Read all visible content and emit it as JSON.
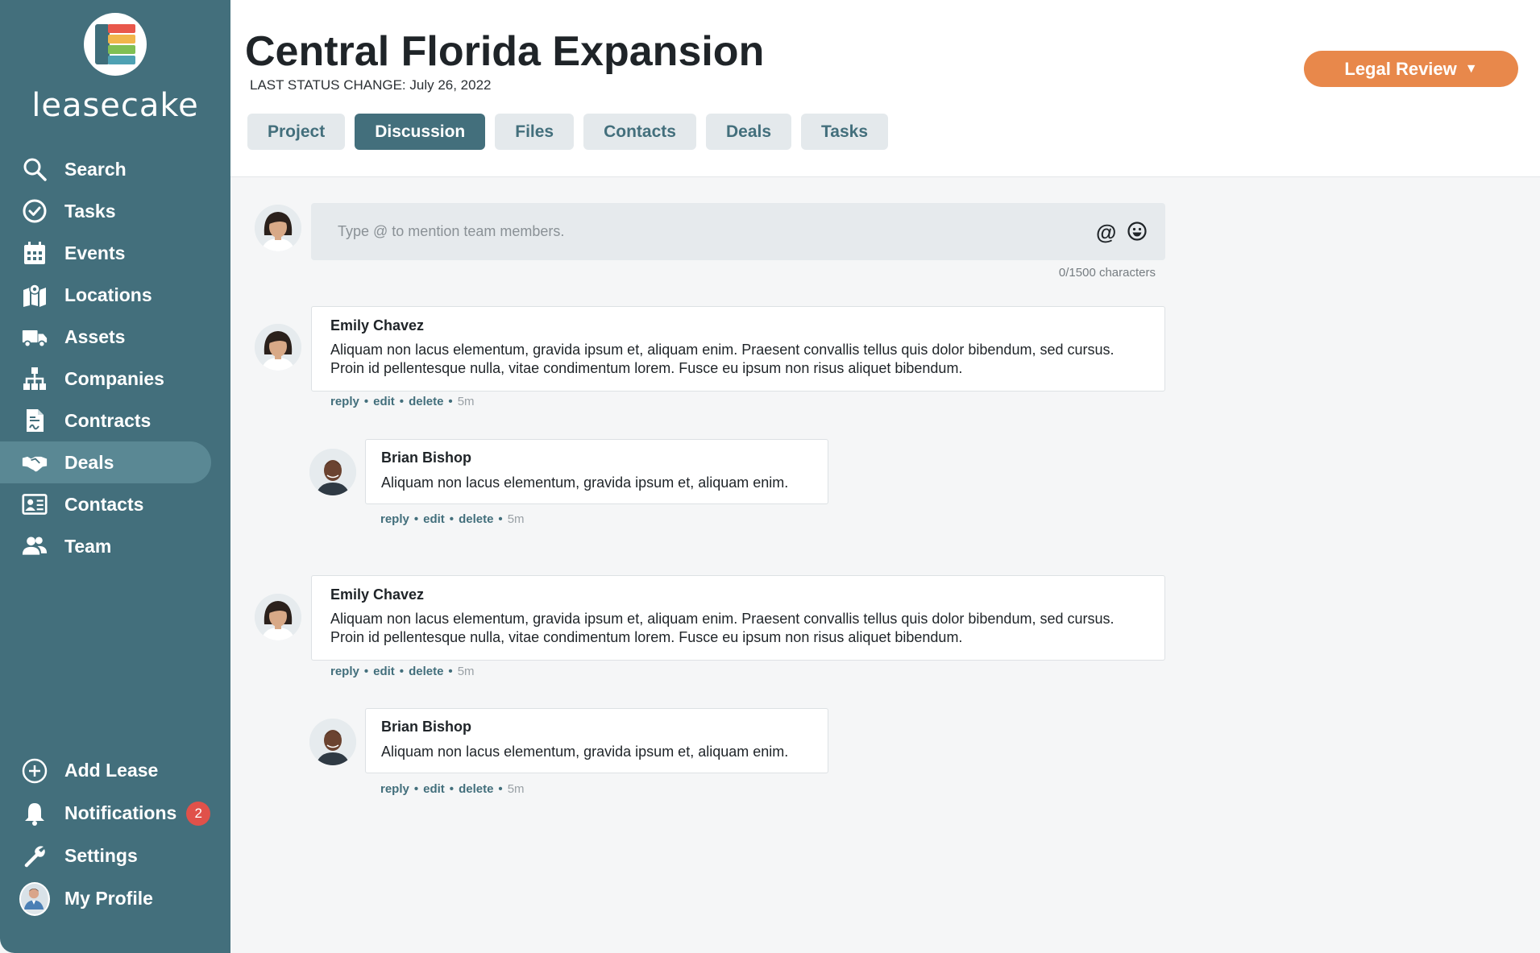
{
  "brand": {
    "name": "leasecake"
  },
  "sidebar": {
    "items": [
      {
        "label": "Search",
        "icon": "search-icon"
      },
      {
        "label": "Tasks",
        "icon": "check-circle-icon"
      },
      {
        "label": "Events",
        "icon": "calendar-icon"
      },
      {
        "label": "Locations",
        "icon": "map-icon"
      },
      {
        "label": "Assets",
        "icon": "truck-icon"
      },
      {
        "label": "Companies",
        "icon": "org-chart-icon"
      },
      {
        "label": "Contracts",
        "icon": "contract-icon"
      },
      {
        "label": "Deals",
        "icon": "handshake-icon",
        "active": true
      },
      {
        "label": "Contacts",
        "icon": "contact-card-icon"
      },
      {
        "label": "Team",
        "icon": "team-icon"
      }
    ],
    "bottom": {
      "add_lease": "Add Lease",
      "notifications": "Notifications",
      "notifications_count": "2",
      "settings": "Settings",
      "profile": "My Profile"
    }
  },
  "header": {
    "title": "Central Florida Expansion",
    "status_change": "LAST STATUS CHANGE: July 26, 2022",
    "status_button": "Legal Review",
    "tabs": [
      "Project",
      "Discussion",
      "Files",
      "Contacts",
      "Deals",
      "Tasks"
    ],
    "active_tab": "Discussion"
  },
  "composer": {
    "placeholder": "Type @ to mention team members.",
    "at_symbol": "@",
    "char_count": "0/1500 characters"
  },
  "actions": {
    "reply": "reply",
    "edit": "edit",
    "delete": "delete"
  },
  "comments": [
    {
      "author": "Emily Chavez",
      "body": "Aliquam non lacus elementum, gravida ipsum et, aliquam enim. Praesent convallis tellus quis dolor bibendum, sed cursus. Proin id pellentesque nulla, vitae condimentum lorem. Fusce eu ipsum non risus aliquet bibendum.",
      "time": "5m",
      "reply": {
        "author": "Brian Bishop",
        "body": "Aliquam non lacus elementum, gravida ipsum et, aliquam enim.",
        "time": "5m"
      }
    },
    {
      "author": "Emily Chavez",
      "body": "Aliquam non lacus elementum, gravida ipsum et, aliquam enim. Praesent convallis tellus quis dolor bibendum, sed cursus. Proin id pellentesque nulla, vitae condimentum lorem. Fusce eu ipsum non risus aliquet bibendum.",
      "time": "5m",
      "reply": {
        "author": "Brian Bishop",
        "body": "Aliquam non lacus elementum, gravida ipsum et, aliquam enim.",
        "time": "5m"
      }
    }
  ],
  "colors": {
    "sidebar": "#436f7c",
    "accent": "#436f7c",
    "status_button": "#e8884b",
    "badge": "#e0514a"
  }
}
